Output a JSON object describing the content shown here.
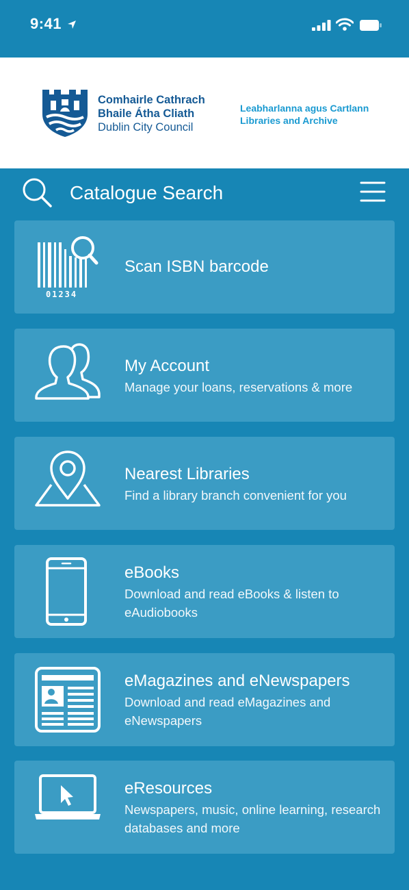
{
  "status_bar": {
    "time": "9:41"
  },
  "header": {
    "council_name": [
      "Comhairle Cathrach",
      "Bhaile Átha Cliath",
      "Dublin City Council"
    ],
    "library_name": [
      "Leabharlanna agus Cartlann",
      "Libraries and Archive"
    ]
  },
  "search": {
    "label": "Catalogue Search"
  },
  "barcode_digits": "01234",
  "colors": {
    "background": "#1786b5",
    "card": "#3b9cc4",
    "logo_navy": "#155a95",
    "logo_cyan": "#1a9ad1"
  },
  "menu": [
    {
      "title": "Scan ISBN barcode",
      "subtitle": "",
      "icon": "barcode-scan-icon"
    },
    {
      "title": "My Account",
      "subtitle": "Manage your loans, reservations & more",
      "icon": "users-icon"
    },
    {
      "title": "Nearest Libraries",
      "subtitle": "Find a library branch convenient for you",
      "icon": "map-pin-icon"
    },
    {
      "title": "eBooks",
      "subtitle": "Download and read eBooks & listen to eAudiobooks",
      "icon": "tablet-icon"
    },
    {
      "title": "eMagazines and eNewspapers",
      "subtitle": "Download and read eMagazines and eNewspapers",
      "icon": "newspaper-icon"
    },
    {
      "title": "eResources",
      "subtitle": "Newspapers, music, online learning, research databases and more",
      "icon": "laptop-icon"
    }
  ]
}
